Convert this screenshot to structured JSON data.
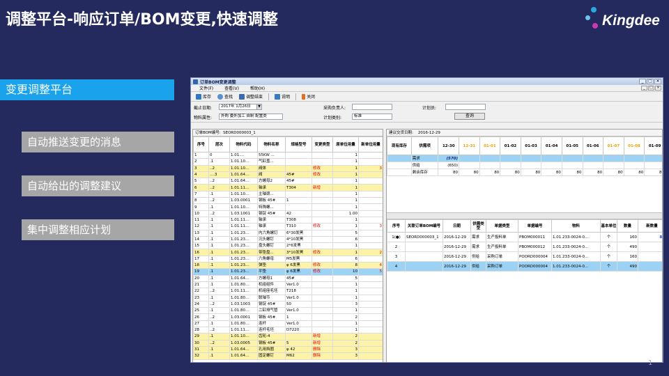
{
  "slide": {
    "title": "调整平台-响应订单/BOM变更,快速调整",
    "page_number": "1",
    "logo_text": "Kingdee",
    "main_label": "变更调整平台",
    "features": [
      "自动推送变更的消息",
      "自动给出的调整建议",
      "集中调整相应计划"
    ]
  },
  "window": {
    "title": "订单BOM变更调整",
    "menus": [
      "文件(F)",
      "查看(V)",
      "帮助(H)"
    ],
    "toolbar": [
      "库存",
      "查找",
      "调整结束",
      "说明",
      "关闭"
    ],
    "form": {
      "cutoff_label": "截止日期:",
      "cutoff_value": "2017年 1月26日",
      "attr_label": "物料属性:",
      "attr_value": "外购 委外加工 自制 配置类",
      "buyer_label": "采购负责人:",
      "plan_type_label": "计划类别:",
      "plan_type_value": "标准",
      "planner_label": "计划员:",
      "query_button": "查询"
    },
    "left": {
      "header_label": "订单BOM编号:",
      "header_value": "SEORD000003_1",
      "columns": [
        "序号",
        "层次",
        "物料代码",
        "物料名称",
        "规格型号",
        "变更类型",
        "原单位用量",
        "新单位用量"
      ],
      "rows": [
        [
          "1",
          "0",
          "1.01....",
          "55KW ...",
          "",
          "",
          "1",
          ""
        ],
        [
          "2",
          ".1",
          "1.01.10...",
          "气缸盖...",
          "",
          "",
          "1",
          ""
        ],
        [
          "3",
          "..2",
          "1.01.10...",
          "阀体",
          "",
          "修改",
          "1",
          "3"
        ],
        [
          "4",
          "....3",
          "1.01.64...",
          "阀",
          "45#",
          "修改",
          "1",
          ""
        ],
        [
          "5",
          "..2",
          "1.01.64...",
          "方螺母2",
          "45#",
          "",
          "1",
          ""
        ],
        [
          "6",
          "..2",
          "1.01.11...",
          "轴承",
          "T304",
          "新增",
          "1",
          ""
        ],
        [
          "7",
          ".1",
          "1.01.10...",
          "主轴颈...",
          "",
          "",
          "1",
          ""
        ],
        [
          "8",
          "..2",
          "1.03.0001",
          "钢板 45#",
          "1",
          "",
          "1",
          ""
        ],
        [
          "9",
          ".1",
          "1.01.10...",
          "特殊螺...",
          "",
          "",
          "1",
          ""
        ],
        [
          "10",
          "..2",
          "1.03.1001",
          "钢锭 45#",
          "42",
          "",
          "1.00",
          ""
        ],
        [
          "11",
          ".1",
          "1.01.11...",
          "轴承",
          "T308",
          "",
          "1",
          ""
        ],
        [
          "12",
          ".1",
          "1.01.11...",
          "轴承",
          "T310",
          "修改",
          "1",
          "3"
        ],
        [
          "13",
          ".1",
          "1.01.23...",
          "内六角螺钉",
          "6*30发黑",
          "",
          "5",
          ""
        ],
        [
          "14",
          ".1",
          "1.01.23...",
          "沉头螺钉",
          "4*10发黑",
          "",
          "6",
          ""
        ],
        [
          "15",
          ".1",
          "1.01.23...",
          "盘头螺钉",
          "2*6发黑",
          "",
          "1",
          ""
        ],
        [
          "16",
          ".1",
          "1.01.23...",
          "带垫盘...",
          "3*10发黑",
          "修改",
          "1",
          "2"
        ],
        [
          "17",
          ".1",
          "1.01.23...",
          "六角螺母",
          "M5发黑",
          "",
          "6",
          ""
        ],
        [
          "18",
          ".1",
          "1.01.23...",
          "弹垫",
          "φ 6发黑",
          "修改",
          "8",
          "4"
        ],
        [
          "19",
          ".1",
          "1.01.23...",
          "平垫",
          "φ 6发黑",
          "修改",
          "10",
          "5"
        ],
        [
          "20",
          ".1",
          "1.01.64...",
          "方螺母1",
          "45#",
          "",
          "5",
          ""
        ],
        [
          "21",
          ".1",
          "1.01.80...",
          "机组组件",
          "Ver1.0",
          "",
          "1",
          ""
        ],
        [
          "22",
          "..2",
          "1.01.11...",
          "机组座毛坯",
          "T218",
          "",
          "1",
          ""
        ],
        [
          "23",
          ".1",
          "1.01.80...",
          "联轴节",
          "Ver1.0",
          "",
          "1",
          ""
        ],
        [
          "24",
          "..2",
          "1.03.1003",
          "钢锭 45#",
          "50",
          "",
          "3",
          ""
        ],
        [
          "25",
          ".1",
          "1.01.80...",
          "二缸排气管",
          "Ver1.0",
          "",
          "1",
          ""
        ],
        [
          "26",
          "..2",
          "1.03.0001",
          "钢板 45#",
          "1",
          "",
          "2",
          ""
        ],
        [
          "27",
          ".1",
          "1.01.80...",
          "连杆",
          "Ver1.0",
          "",
          "1",
          ""
        ],
        [
          "28",
          "..2",
          "1.01.11...",
          "连杆毛坯",
          "D7220",
          "",
          "1",
          ""
        ],
        [
          "29",
          ".1",
          "1.01.10...",
          "齿轮-4",
          "",
          "新增",
          "2",
          ""
        ],
        [
          "30",
          "..2",
          "1.03.0005",
          "钢板 45#",
          "5",
          "新增",
          "2",
          ""
        ],
        [
          "31",
          ".1",
          "1.01.64...",
          "孔用挡圈",
          "φ 42",
          "删除",
          "3",
          ""
        ],
        [
          "32",
          ".1",
          "1.01.64...",
          "固定螺钉",
          "M62",
          "删除",
          "3",
          ""
        ]
      ],
      "highlight": {
        "yellow": [
          3,
          4,
          6,
          16,
          18,
          29,
          30,
          31,
          32
        ],
        "blue": [
          19
        ]
      }
    },
    "right": {
      "header_label": "建议交货日期:",
      "header_value": "2016-12-29",
      "schedule_columns": [
        "现有库存",
        "供需项",
        "12-30",
        "12-31",
        "01-01",
        "01-02",
        "01-03",
        "01-04",
        "01-05",
        "01-06",
        "01-07",
        "01-08",
        "01-09"
      ],
      "highlight_dates": [
        "12-31",
        "01-01",
        "01-07",
        "01-08"
      ],
      "schedule_rows": [
        [
          "",
          "需求",
          "(570)",
          "",
          "",
          "",
          "",
          "",
          "",
          "",
          "",
          "",
          ""
        ],
        [
          "",
          "供给",
          "(650)",
          "",
          "",
          "",
          "",
          "",
          "",
          "",
          "",
          "",
          ""
        ],
        [
          "",
          "剩余库存",
          "80",
          "80",
          "80",
          "80",
          "80",
          "80",
          "80",
          "80",
          "80",
          "80",
          "80"
        ]
      ],
      "order_columns": [
        "序号",
        "关联订单BOM编号",
        "日期",
        "供需类型",
        "单据类型",
        "单据编号",
        "物料",
        "基本单位",
        "数量",
        "新数量"
      ],
      "order_rows": [
        [
          "1(●)",
          "SEORD000003_1",
          "2016-12-29",
          "需求",
          "生产投料单",
          "PBOM000011",
          "1.01.233-0024-0...",
          "个",
          "160",
          "80"
        ],
        [
          "2",
          "",
          "2016-12-29",
          "需求",
          "生产投料单",
          "PBOM000012",
          "1.01.233-0024-0...",
          "个",
          "490",
          ""
        ],
        [
          "3",
          "",
          "2016-12-29",
          "供给",
          "采购订单",
          "POORD000004",
          "1.01.233-0024-0...",
          "个",
          "160",
          ""
        ],
        [
          "4",
          "",
          "2016-12-29",
          "供给",
          "采购订单",
          "POORD000004",
          "1.01.233-0024-0...",
          "个",
          "490",
          ""
        ]
      ]
    }
  },
  "colors": {
    "background": "#242a5e",
    "accent_blue": "#1aa3ec",
    "feature_gray": "#a6a6a6",
    "row_yellow": "#fdf3a6",
    "row_blue": "#9cd2f4",
    "change_red": "#e00000"
  }
}
